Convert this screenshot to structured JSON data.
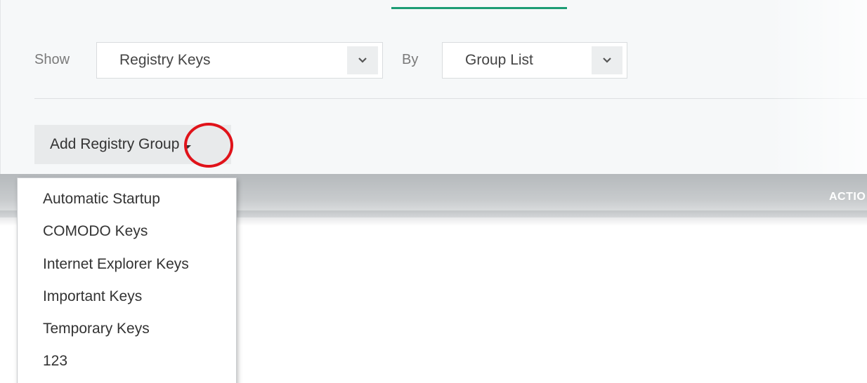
{
  "filter": {
    "show_label": "Show",
    "show_value": "Registry Keys",
    "by_label": "By",
    "by_value": "Group List"
  },
  "toolbar": {
    "add_group_label": "Add Registry Group"
  },
  "table": {
    "actions_header": "ACTIO"
  },
  "dropdown": {
    "items": [
      "Automatic Startup",
      "COMODO Keys",
      "Internet Explorer Keys",
      "Important Keys",
      "Temporary Keys",
      "123"
    ]
  },
  "colors": {
    "accent": "#1c9c74",
    "highlight": "#e0131a"
  },
  "icons": {
    "select_caret": "chevron-down-icon",
    "button_caret": "caret-down-icon"
  }
}
